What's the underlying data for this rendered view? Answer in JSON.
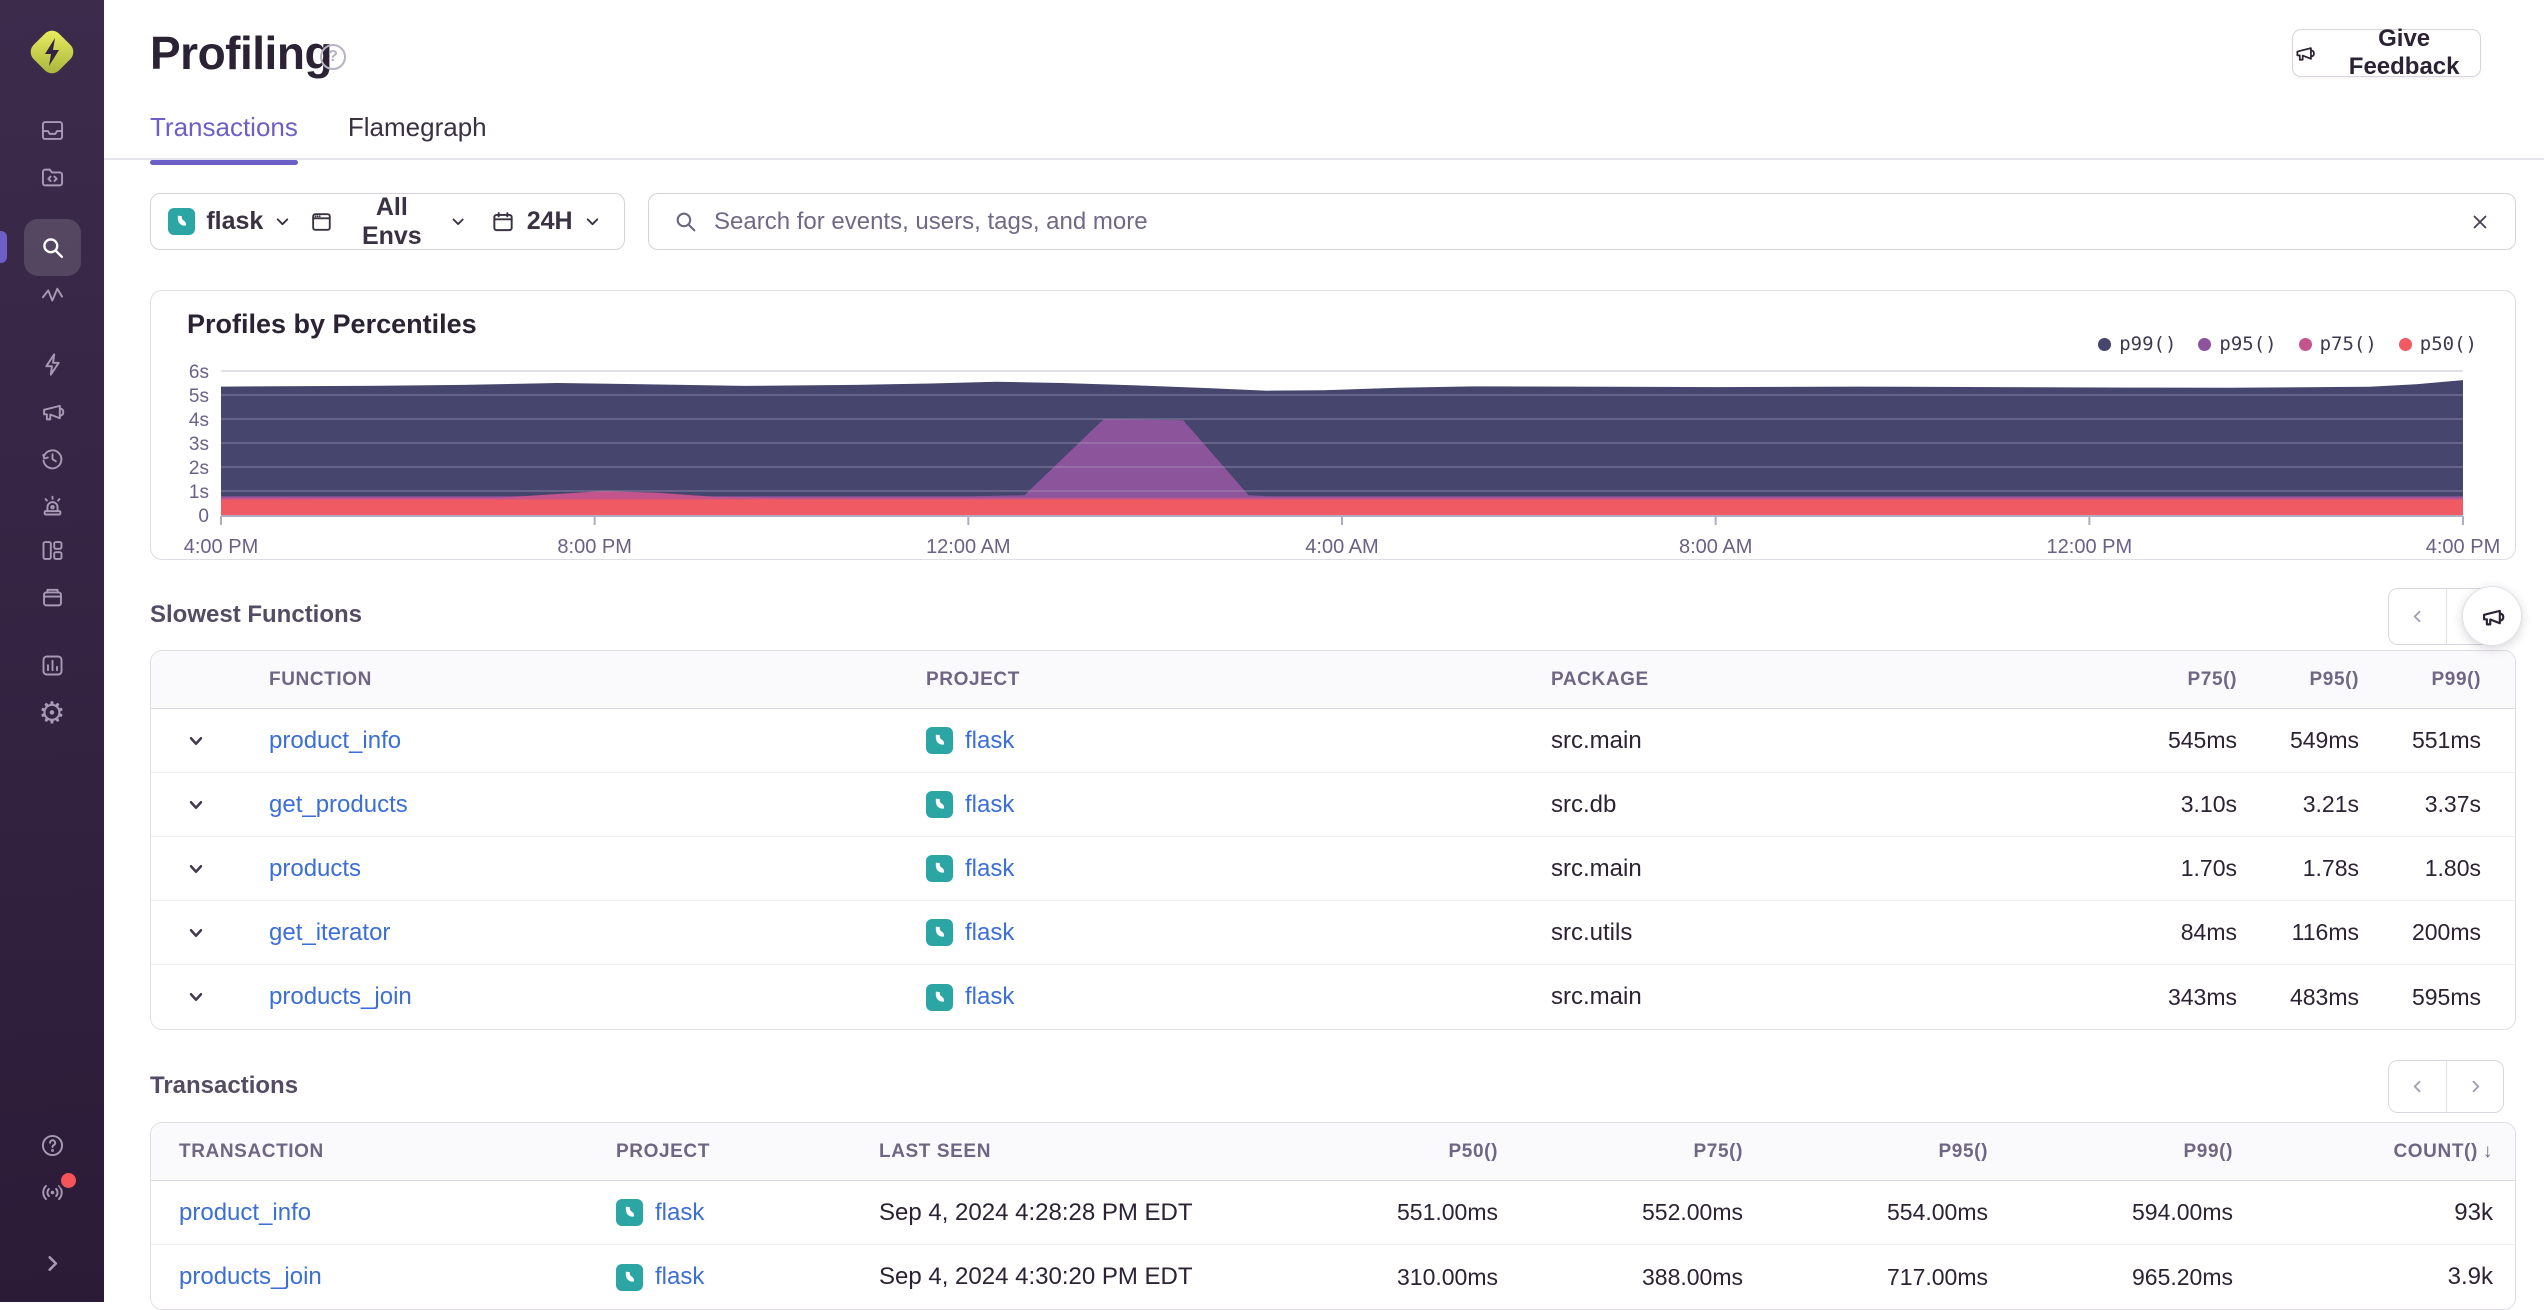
{
  "sidebar": {
    "logo": "sentry-logo",
    "items": [
      "issues",
      "projects",
      "search",
      "performance",
      "lightning",
      "feedback-megaphone",
      "replays-clock",
      "alerts-siren",
      "dashboards-grid",
      "releases-archive",
      "stats-chart",
      "settings-gear"
    ],
    "active_item": "search",
    "footer_items": [
      "help",
      "whats-new",
      "collapse"
    ],
    "notification_dot_color": "#f55459",
    "gear_glyph": "⚙"
  },
  "header": {
    "title": "Profiling",
    "help_glyph": "?",
    "feedback_button_label": "Give Feedback"
  },
  "tabs": {
    "transactions": "Transactions",
    "flamegraph": "Flamegraph"
  },
  "filters": {
    "project_label": "flask",
    "environment_label": "All Envs",
    "date_range_label": "24H"
  },
  "search": {
    "placeholder": "Search for events, users, tags, and more"
  },
  "chart_data": {
    "type": "area",
    "title": "Profiles by Percentiles",
    "legend_position": "top-right",
    "grid": true,
    "ylim": [
      0,
      6
    ],
    "xlim": [
      0,
      24
    ],
    "ylabel_ticks": [
      "0",
      "1s",
      "2s",
      "3s",
      "4s",
      "5s",
      "6s"
    ],
    "x_ticks": [
      "4:00 PM",
      "8:00 PM",
      "12:00 AM",
      "4:00 AM",
      "8:00 AM",
      "12:00 PM",
      "4:00 PM"
    ],
    "series": [
      {
        "name": "p99()",
        "color": "#45456d",
        "points": [
          [
            0,
            5.35
          ],
          [
            1.5,
            5.38
          ],
          [
            2.6,
            5.42
          ],
          [
            3.6,
            5.5
          ],
          [
            4.6,
            5.44
          ],
          [
            5.6,
            5.38
          ],
          [
            6.8,
            5.42
          ],
          [
            7.6,
            5.48
          ],
          [
            8.3,
            5.55
          ],
          [
            9,
            5.5
          ],
          [
            9.8,
            5.4
          ],
          [
            10.6,
            5.28
          ],
          [
            11.2,
            5.18
          ],
          [
            11.8,
            5.2
          ],
          [
            12.6,
            5.3
          ],
          [
            13.4,
            5.36
          ],
          [
            14.5,
            5.35
          ],
          [
            16,
            5.33
          ],
          [
            17.5,
            5.35
          ],
          [
            19,
            5.33
          ],
          [
            20.5,
            5.31
          ],
          [
            21.5,
            5.3
          ],
          [
            22.3,
            5.32
          ],
          [
            23,
            5.34
          ],
          [
            23.5,
            5.45
          ],
          [
            24,
            5.62
          ]
        ]
      },
      {
        "name": "p95()",
        "color": "#8c549b",
        "points": [
          [
            0,
            0.78
          ],
          [
            8,
            0.78
          ],
          [
            8.6,
            0.82
          ],
          [
            9.45,
            4.0
          ],
          [
            10.3,
            3.95
          ],
          [
            11.0,
            0.82
          ],
          [
            11.2,
            0.78
          ],
          [
            24,
            0.78
          ]
        ]
      },
      {
        "name": "p75()",
        "color": "#c4548c",
        "points": [
          [
            0,
            0.72
          ],
          [
            3,
            0.73
          ],
          [
            3.5,
            0.85
          ],
          [
            4.1,
            1.0
          ],
          [
            4.7,
            0.92
          ],
          [
            5.3,
            0.75
          ],
          [
            6,
            0.72
          ],
          [
            24,
            0.72
          ]
        ]
      },
      {
        "name": "p50()",
        "color": "#ef5a63",
        "points": [
          [
            0,
            0.64
          ],
          [
            6,
            0.65
          ],
          [
            12,
            0.64
          ],
          [
            18,
            0.64
          ],
          [
            24,
            0.64
          ]
        ]
      }
    ]
  },
  "slowest_functions": {
    "title": "Slowest Functions",
    "columns": {
      "function": "Function",
      "project": "Project",
      "package": "Package",
      "p75": "P75()",
      "p95": "P95()",
      "p99": "P99()"
    },
    "rows": [
      {
        "function": "product_info",
        "project": "flask",
        "package": "src.main",
        "p75": "545ms",
        "p95": "549ms",
        "p99": "551ms"
      },
      {
        "function": "get_products",
        "project": "flask",
        "package": "src.db",
        "p75": "3.10s",
        "p95": "3.21s",
        "p99": "3.37s"
      },
      {
        "function": "products",
        "project": "flask",
        "package": "src.main",
        "p75": "1.70s",
        "p95": "1.78s",
        "p99": "1.80s"
      },
      {
        "function": "get_iterator",
        "project": "flask",
        "package": "src.utils",
        "p75": "84ms",
        "p95": "116ms",
        "p99": "200ms"
      },
      {
        "function": "products_join",
        "project": "flask",
        "package": "src.main",
        "p75": "343ms",
        "p95": "483ms",
        "p99": "595ms"
      }
    ]
  },
  "transactions": {
    "title": "Transactions",
    "columns": {
      "transaction": "Transaction",
      "project": "Project",
      "last_seen": "Last Seen",
      "p50": "P50()",
      "p75": "P75()",
      "p95": "P95()",
      "p99": "P99()",
      "count": "Count()"
    },
    "sort_arrow": "↓",
    "rows": [
      {
        "transaction": "product_info",
        "project": "flask",
        "last_seen": "Sep 4, 2024 4:28:28 PM EDT",
        "p50": "551.00ms",
        "p75": "552.00ms",
        "p95": "554.00ms",
        "p99": "594.00ms",
        "count": "93k"
      },
      {
        "transaction": "products_join",
        "project": "flask",
        "last_seen": "Sep 4, 2024 4:30:20 PM EDT",
        "p50": "310.00ms",
        "p75": "388.00ms",
        "p95": "717.00ms",
        "p99": "965.20ms",
        "count": "3.9k"
      }
    ]
  }
}
